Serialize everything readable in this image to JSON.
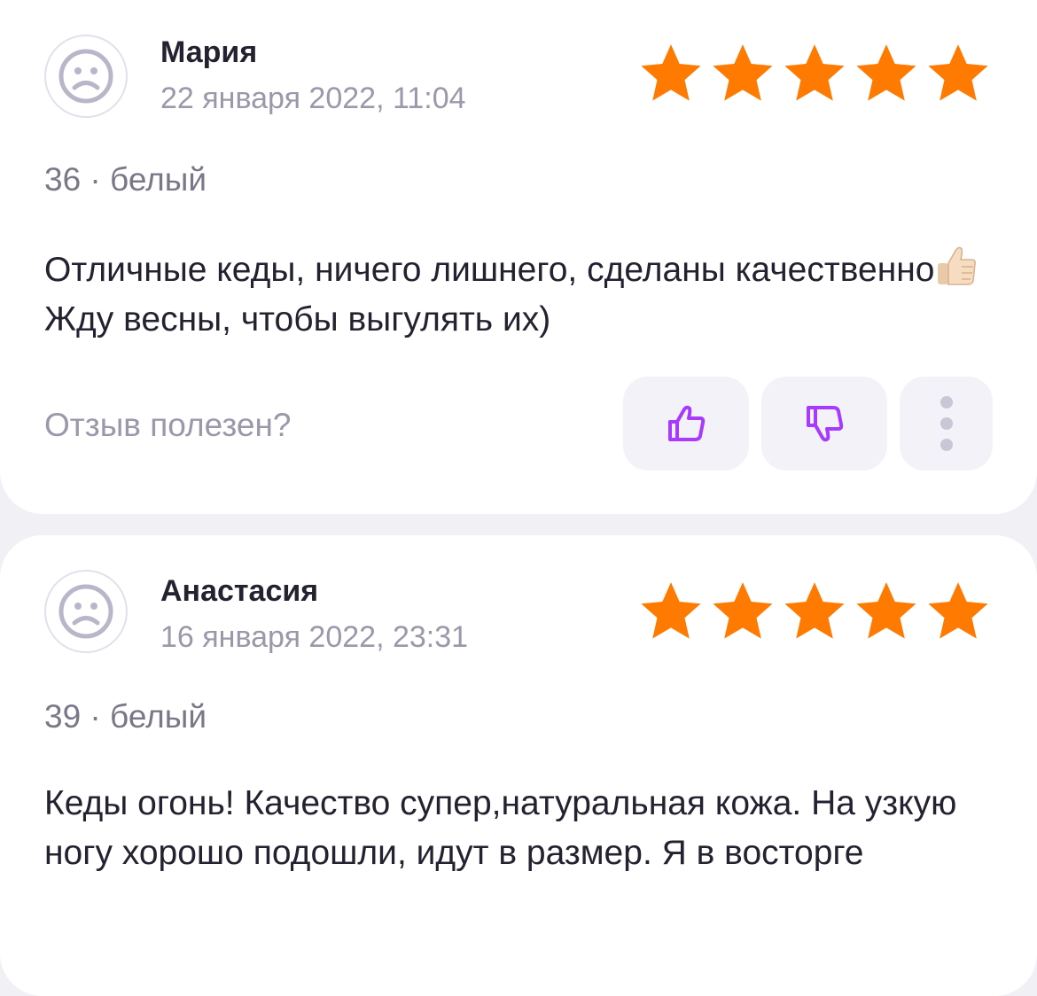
{
  "colors": {
    "star": "#ff7a00",
    "accent": "#a73afd",
    "muted_text": "#9a98aa",
    "text": "#242230"
  },
  "icons": {
    "avatar": "sad-face-icon",
    "rating": "star-icon",
    "like": "thumbs-up-icon",
    "dislike": "thumbs-down-icon",
    "more": "more-vertical-icon",
    "emoji": "thumbs-up-emoji"
  },
  "reviews": [
    {
      "author": "Мария",
      "date": "22 января 2022, 11:04",
      "rating": 5,
      "size_color": "36 · белый",
      "text_part1": "Отличные кеды, ничего лишнего, сделаны качественно",
      "text_part2": " Жду весны, чтобы выгулять их)",
      "helpful_question": "Отзыв полезен?"
    },
    {
      "author": "Анастасия",
      "date": "16 января 2022, 23:31",
      "rating": 5,
      "size_color": "39 · белый",
      "text": "Кеды огонь! Качество супер,натуральная кожа. На узкую ногу хорошо подошли, идут в размер. Я в восторге"
    }
  ]
}
